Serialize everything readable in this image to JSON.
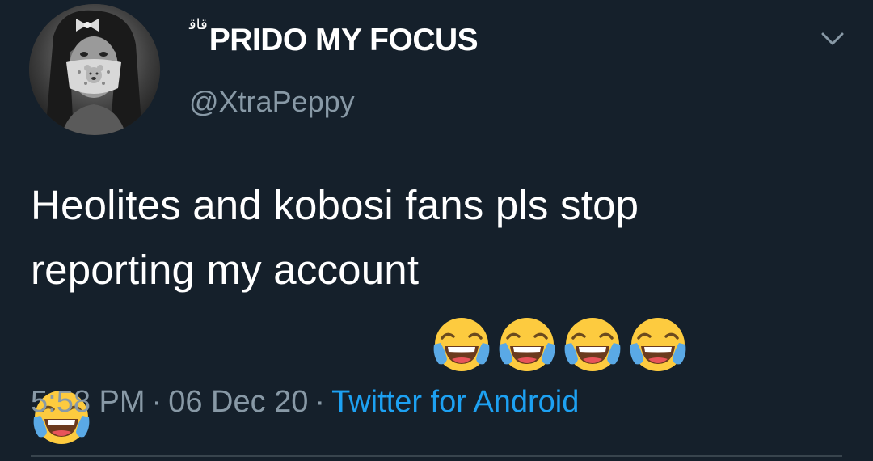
{
  "tweet": {
    "author": {
      "name_glyph": "ﻗﺎﻗ",
      "display_name": "PRIDO MY FOCUS",
      "handle": "@XtraPeppy"
    },
    "text": {
      "line1": "Heolites and kobosi fans pls stop",
      "line2": "reporting my account "
    },
    "emojis": [
      "face-with-tears-of-joy",
      "face-with-tears-of-joy",
      "face-with-tears-of-joy",
      "face-with-tears-of-joy",
      "face-with-tears-of-joy"
    ],
    "meta": {
      "time": "5:58 PM",
      "separator": "·",
      "date": "06 Dec 20",
      "source": "Twitter for Android"
    },
    "menu_icon": "chevron-down-icon"
  },
  "colors": {
    "background": "#15202b",
    "text": "#ffffff",
    "secondary": "#8899a6",
    "link": "#1da1f2",
    "divider": "#38444d"
  }
}
